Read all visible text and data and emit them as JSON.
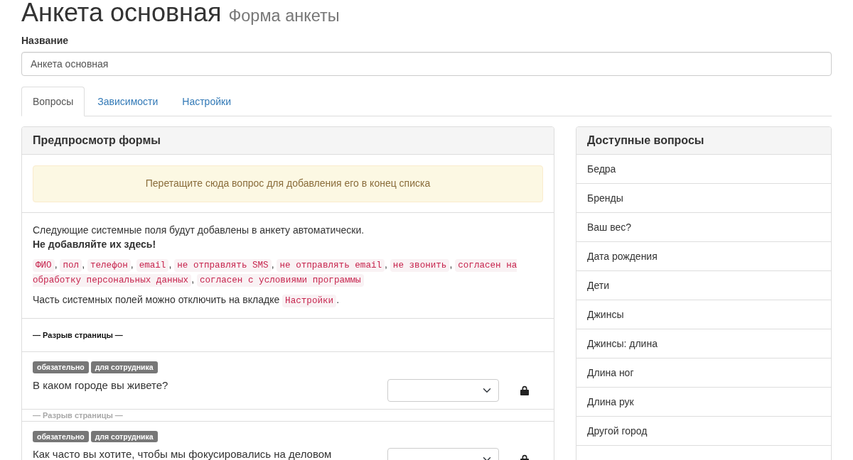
{
  "header": {
    "title": "Анкета основная",
    "subtitle": "Форма анкеты"
  },
  "name_field": {
    "label": "Название",
    "value": "Анкета основная"
  },
  "tabs": [
    {
      "label": "Вопросы",
      "selected": true
    },
    {
      "label": "Зависимости",
      "selected": false
    },
    {
      "label": "Настройки",
      "selected": false
    }
  ],
  "preview": {
    "title": "Предпросмотр формы",
    "drop_hint": "Перетащите сюда вопрос для добавления его в конец списка",
    "system_fields": {
      "intro": "Следующие системные поля будут добавлены в анкету автоматически.",
      "warning": "Не добавляйте их здесь!",
      "fields": [
        "ФИО",
        "пол",
        "телефон",
        "email",
        "не отправлять SMS",
        "не отправлять email",
        "не звонить",
        "согласен на обработку персональных данных",
        "согласен с условиями программы"
      ],
      "separator": ",",
      "note": {
        "before": "Часть системных полей можно отключить на вкладке",
        "code": "Настройки",
        "after": "."
      }
    },
    "items": [
      {
        "kind": "page_break",
        "text": "— Разрыв страницы —"
      },
      {
        "kind": "question",
        "tags": [
          "обязательно",
          "для сотрудника"
        ],
        "text": "В каком городе вы живете?",
        "locked": true
      },
      {
        "kind": "page_break_ghost",
        "text": "— Разрыв страницы —"
      },
      {
        "kind": "question",
        "tags": [
          "обязательно",
          "для сотрудника"
        ],
        "text": "Как часто вы хотите, чтобы мы фокусировались на деловом",
        "locked": true
      }
    ]
  },
  "available_questions": {
    "title": "Доступные вопросы",
    "items": [
      "Бедра",
      "Бренды",
      "Ваш вес?",
      "Дата рождения",
      "Дети",
      "Джинсы",
      "Джинсы: длина",
      "Длина ног",
      "Длина рук",
      "Другой город"
    ]
  }
}
